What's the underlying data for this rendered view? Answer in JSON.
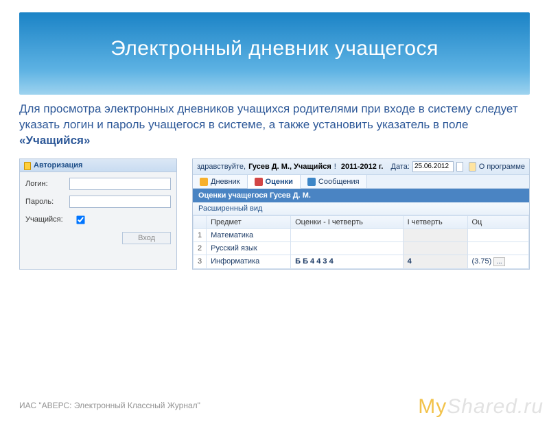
{
  "slide": {
    "title": "Электронный дневник учащегося",
    "description_prefix": "Для просмотра электронных дневников учащихся родителями при входе в систему следует указать логин и пароль учащегося в системе, а также установить указатель в поле ",
    "description_bold": "«Учащийся»",
    "footer": "ИАС \"АВЕРС: Электронный Классный Журнал\"",
    "watermark_left": "MyShared",
    "watermark_right": ".ru"
  },
  "auth": {
    "header": "Авторизация",
    "login_label": "Логин:",
    "password_label": "Пароль:",
    "student_label": "Учащийся:",
    "student_checked": true,
    "submit": "Вход"
  },
  "grades": {
    "greeting_prefix": "здравствуйте, ",
    "greeting_name": "Гусев Д. М., Учащийся",
    "year": "2011-2012 г.",
    "date_label": "Дата:",
    "date_value": "25.06.2012",
    "about": "О программе",
    "tabs": [
      {
        "label": "Дневник",
        "active": false
      },
      {
        "label": "Оценки",
        "active": true
      },
      {
        "label": "Сообщения",
        "active": false
      }
    ],
    "bluebar": "Оценки учащегося Гусев Д. М.",
    "expand": "Расширенный вид",
    "columns": [
      "",
      "Предмет",
      "Оценки - I четверть",
      "I четверть",
      "Оц"
    ],
    "rows": [
      {
        "n": "1",
        "subject": "Математика",
        "marks": "",
        "qtr": "",
        "tail": ""
      },
      {
        "n": "2",
        "subject": "Русский язык",
        "marks": "",
        "qtr": "",
        "tail": ""
      },
      {
        "n": "3",
        "subject": "Информатика",
        "marks": "Б Б 4 4 3 4",
        "qtr": "4",
        "tail": "(3.75)"
      }
    ]
  }
}
